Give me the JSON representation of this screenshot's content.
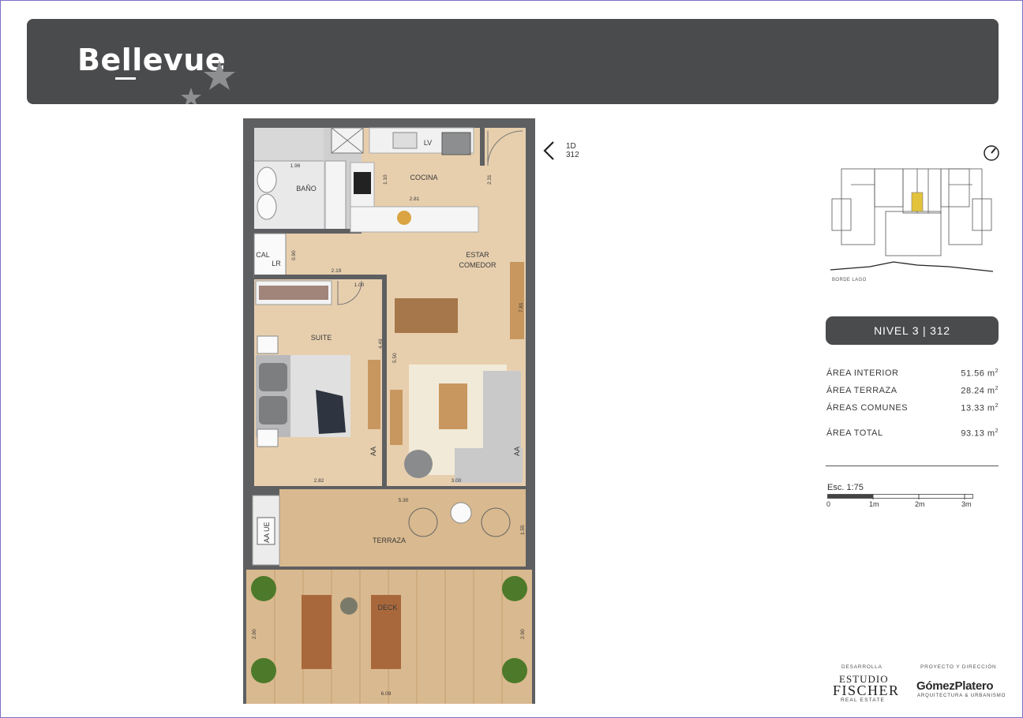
{
  "header": {
    "brand": "Bellevue"
  },
  "plan": {
    "unit_code_line1": "1D",
    "unit_code_line2": "312",
    "rooms": {
      "bano": "BAÑO",
      "cocina": "COCINA",
      "lv": "LV",
      "estar": "ESTAR",
      "comedor": "COMEDOR",
      "suite": "SUITE",
      "terraza": "TERRAZA",
      "deck": "DECK",
      "cal": "CAL",
      "lr": "LR",
      "aa": "AA",
      "aa_ue": "AA UE"
    },
    "dimensions": {
      "d196": "1.96",
      "d110": "1.10",
      "d281": "2.81",
      "d231": "2.31",
      "d090": "0.90",
      "d219": "2.19",
      "d100": "1.00",
      "d781": "7.81",
      "d449": "4.49",
      "d550": "5.50",
      "d282": "2.82",
      "d300": "3.00",
      "d530": "5.30",
      "d155": "1.55",
      "d290a": "2.90",
      "d290b": "2.90",
      "d609": "6.09"
    }
  },
  "keyplan": {
    "label": "BORDE LAGO"
  },
  "unit": {
    "nivel_label": "NIVEL 3 | 312"
  },
  "areas": [
    {
      "label": "ÁREA INTERIOR",
      "value": "51.56 m",
      "unit_sup": "2"
    },
    {
      "label": "ÁREA TERRAZA",
      "value": "28.24 m",
      "unit_sup": "2"
    },
    {
      "label": "ÁREAS COMUNES",
      "value": "13.33 m",
      "unit_sup": "2"
    },
    {
      "label": "ÁREA TOTAL",
      "value": "93.13 m",
      "unit_sup": "2"
    }
  ],
  "scale": {
    "label": "Esc. 1:75",
    "ticks": [
      "0",
      "1m",
      "2m",
      "3m"
    ]
  },
  "credits": {
    "developer_label": "DESARROLLA",
    "developer_line1": "ESTUDIO",
    "developer_line2": "FISCHER",
    "developer_line3": "REAL ESTATE",
    "architect_label": "PROYECTO Y DIRECCIÓN",
    "architect_name": "GómezPlatero",
    "architect_sub": "ARQUITECTURA & URBANISMO"
  },
  "colors": {
    "header_bg": "#4a4b4d",
    "wall": "#5e5f61",
    "floor_wood": "#e7cfae",
    "deck_wood": "#d9b98f",
    "keyplan_highlight": "#e3c33b"
  }
}
